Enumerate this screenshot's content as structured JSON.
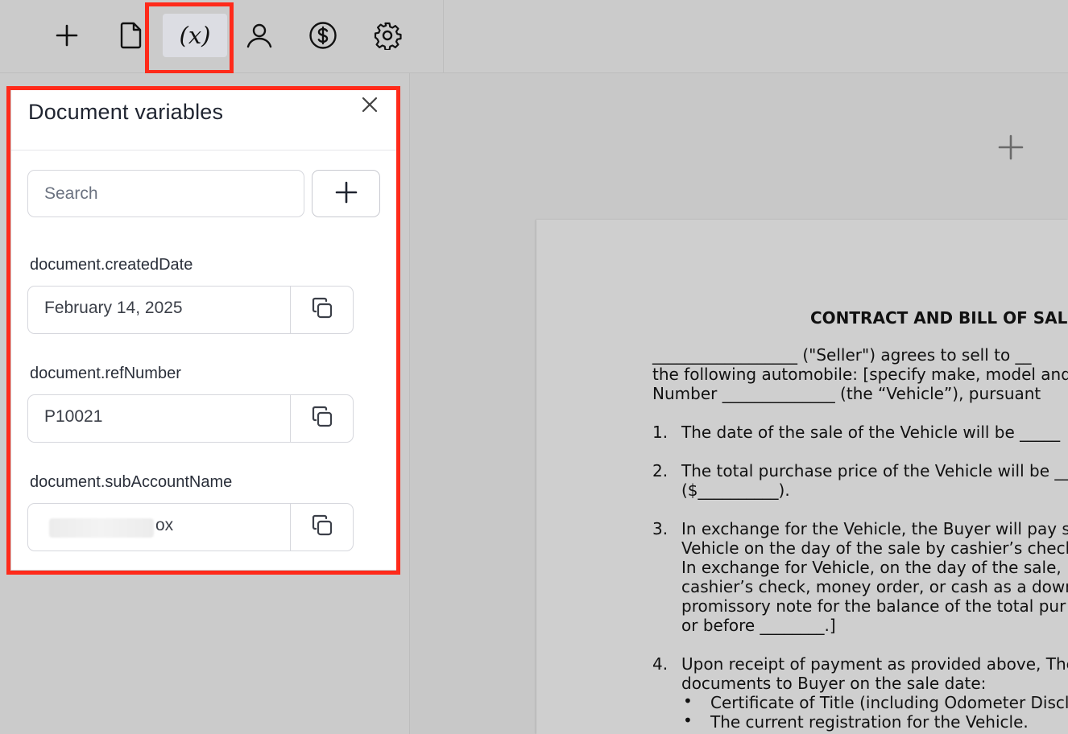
{
  "toolbar": {
    "buttons": [
      {
        "icon": "plus-icon"
      },
      {
        "icon": "document-icon"
      },
      {
        "icon": "variables-icon",
        "label": "(x)",
        "active": true
      },
      {
        "icon": "user-icon"
      },
      {
        "icon": "dollar-icon"
      },
      {
        "icon": "gear-icon"
      }
    ]
  },
  "colors": {
    "highlight": "#ff2a1a",
    "panel_bg": "#ffffff",
    "page_bg": "#c8c8c8"
  },
  "panel": {
    "title": "Document variables",
    "search_placeholder": "Search",
    "variables": [
      {
        "name": "document.createdDate",
        "value": "February 14, 2025"
      },
      {
        "name": "document.refNumber",
        "value": "P10021"
      },
      {
        "name": "document.subAccountName",
        "value": "ox",
        "redacted": true
      }
    ]
  },
  "document": {
    "title": "CONTRACT AND BILL OF SAL",
    "lines": [
      "__________________ (\"Seller\") agrees to sell to __",
      "the following automobile: [specify make, model and",
      "Number ______________ (the “Vehicle”), pursuant",
      "1.",
      "The date of the sale of the Vehicle will be _____",
      "2.",
      "The total purchase price of the Vehicle will be __",
      "($__________).",
      "3.",
      "In exchange for the Vehicle, the Buyer will pay s",
      "Vehicle on the day of the sale by cashier’s check",
      "In exchange for Vehicle, on the day of the sale,",
      "cashier’s check, money order, or cash as a down",
      "promissory note for the balance of the total pur",
      "or before ________.]",
      "4.",
      "Upon receipt of payment as provided above, The",
      "documents to Buyer on the sale date:",
      "•",
      "Certificate of Title (including Odometer Discl",
      "•",
      "The current registration for the Vehicle."
    ]
  }
}
